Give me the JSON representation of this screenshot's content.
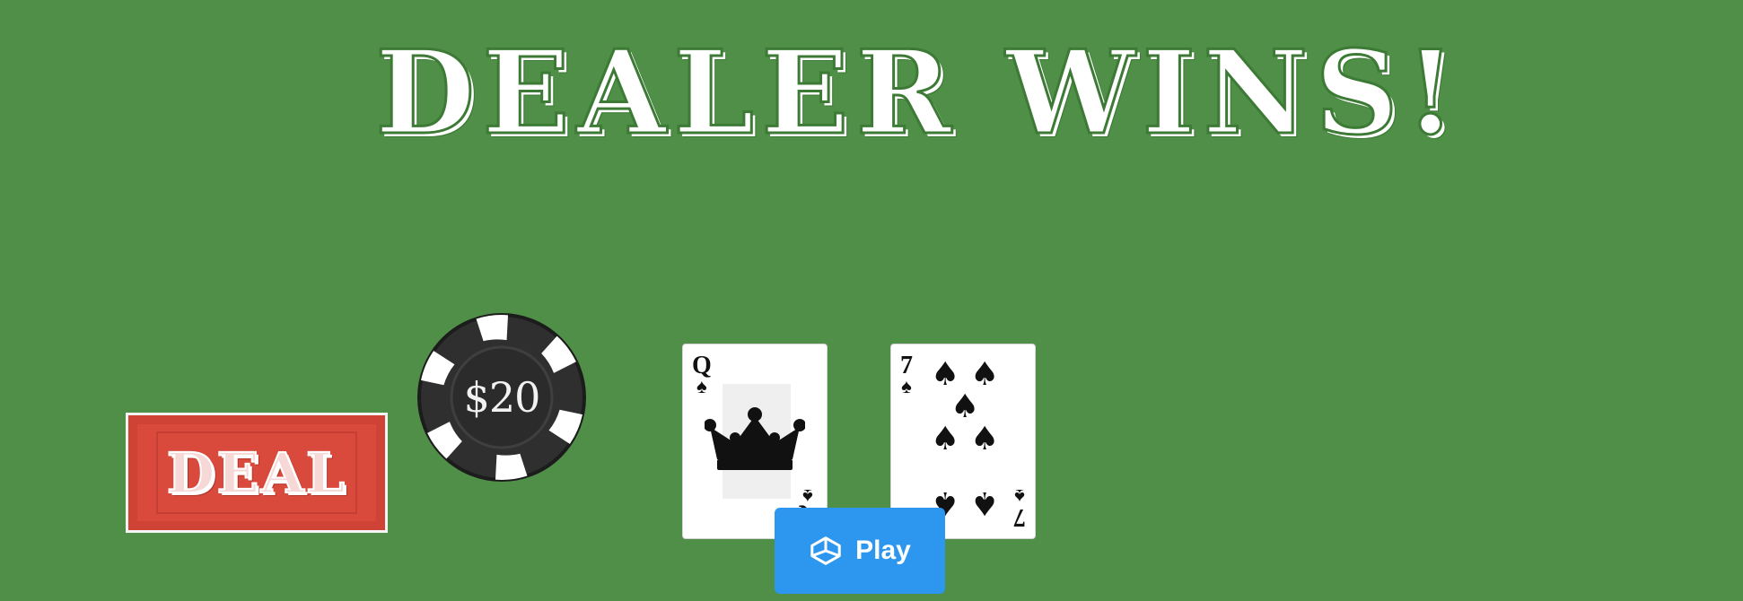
{
  "game": {
    "title": "DEALER WINS!",
    "deal_button_label": "DEAL",
    "chip_value": "$20",
    "play_button_label": "Play",
    "cards": [
      {
        "rank": "Q",
        "suit": "♠",
        "face": "crown-icon"
      },
      {
        "rank": "7",
        "suit": "♠"
      }
    ]
  },
  "colors": {
    "felt": "#508f47",
    "deal_button": "#d94a3d",
    "chip": "#333333",
    "play_button": "#2d96ee"
  }
}
